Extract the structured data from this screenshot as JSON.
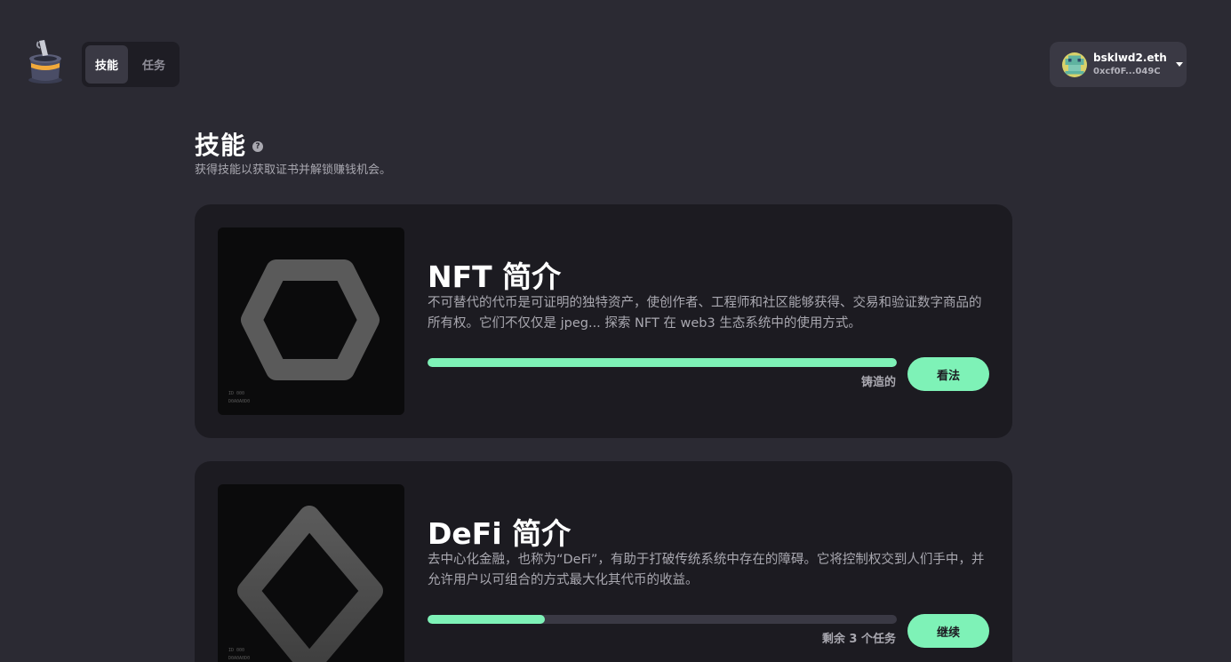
{
  "header": {
    "tabs": [
      {
        "label": "技能",
        "active": true
      },
      {
        "label": "任务",
        "active": false
      }
    ],
    "wallet": {
      "name": "bsklwd2.eth",
      "address": "0xcf0F...049C"
    }
  },
  "main": {
    "title": "技能",
    "subtitle": "获得技能以获取证书并解锁赚钱机会。"
  },
  "skills": [
    {
      "title": "NFT 简介",
      "description": "不可替代的代币是可证明的独特资产，使创作者、工程师和社区能够获得、交易和验证数字商品的所有权。它们不仅仅是 jpeg... 探索 NFT 在 web3 生态系统中的使用方式。",
      "progress": 1.0,
      "status": "铸造的",
      "button": "看法",
      "thumb_code": [
        "ID  000",
        "D0A0A0D0"
      ]
    },
    {
      "title": "DeFi 简介",
      "description": "去中心化金融，也称为“DeFi”，有助于打破传统系统中存在的障碍。它将控制权交到人们手中，并允许用户以可组合的方式最大化其代币的收益。",
      "progress": 0.25,
      "status": "剩余 3 个任务",
      "button": "继续",
      "thumb_code": [
        "ID  000",
        "D0A0A0D0"
      ]
    }
  ],
  "colors": {
    "background": "#2b2a33",
    "card": "#1c1b21",
    "accent": "#7ef2b7"
  }
}
